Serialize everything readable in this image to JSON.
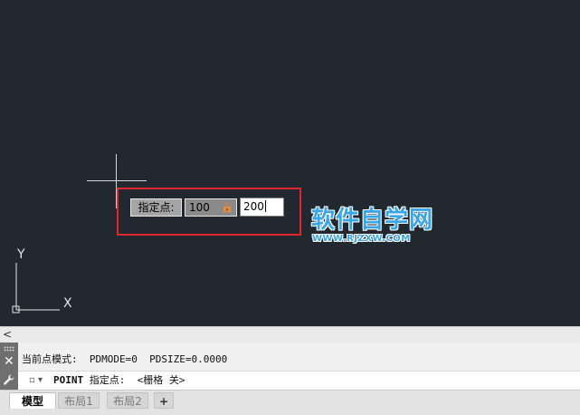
{
  "canvas": {
    "background": "#212830",
    "ucs": {
      "y_label": "Y",
      "x_label": "X"
    }
  },
  "dynamic_input": {
    "prompt": "指定点:",
    "x_value": "100",
    "y_value": "200",
    "lock_icon": "lock-icon",
    "highlight_color": "#e0272c"
  },
  "watermark": {
    "title": "软件自学网",
    "url": "WWW.RJZXW.COM",
    "color": "#38a5e8"
  },
  "scrollbar": {
    "left_arrow": "<"
  },
  "command": {
    "history": "当前点模式:  PDMODE=0  PDSIZE=0.0000",
    "recent_icon": "▫ ▾",
    "command_name": "POINT",
    "prompt_text": " 指定点:  <栅格 关>"
  },
  "tabs": [
    {
      "label": "模型",
      "active": true
    },
    {
      "label": "布局1",
      "active": false
    },
    {
      "label": "布局2",
      "active": false
    },
    {
      "label": "+",
      "active": false
    }
  ]
}
